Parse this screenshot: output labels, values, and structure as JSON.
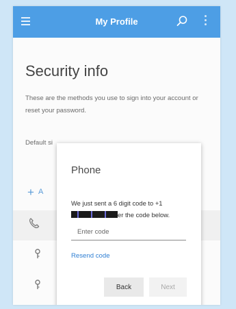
{
  "app_bar": {
    "title": "My Profile",
    "left_icon": "hamburger-menu-icon",
    "right_icons": [
      "search-icon",
      "more-vertical-icon"
    ],
    "color": "#4d9ee5"
  },
  "page": {
    "title": "Security info",
    "description": "These are the methods you use to sign into your account or reset your password.",
    "default_label_partial": "Default sign-in method: notific",
    "add_method_partial": "A"
  },
  "dialog": {
    "title": "Phone",
    "message_start": "We just sent a 6 digit code to +1",
    "message_end": "er the code below.",
    "code_input_placeholder": "Enter code",
    "resend_label": "Resend code",
    "back_label": "Back",
    "next_label": "Next",
    "link_color": "#2f7fd3"
  }
}
